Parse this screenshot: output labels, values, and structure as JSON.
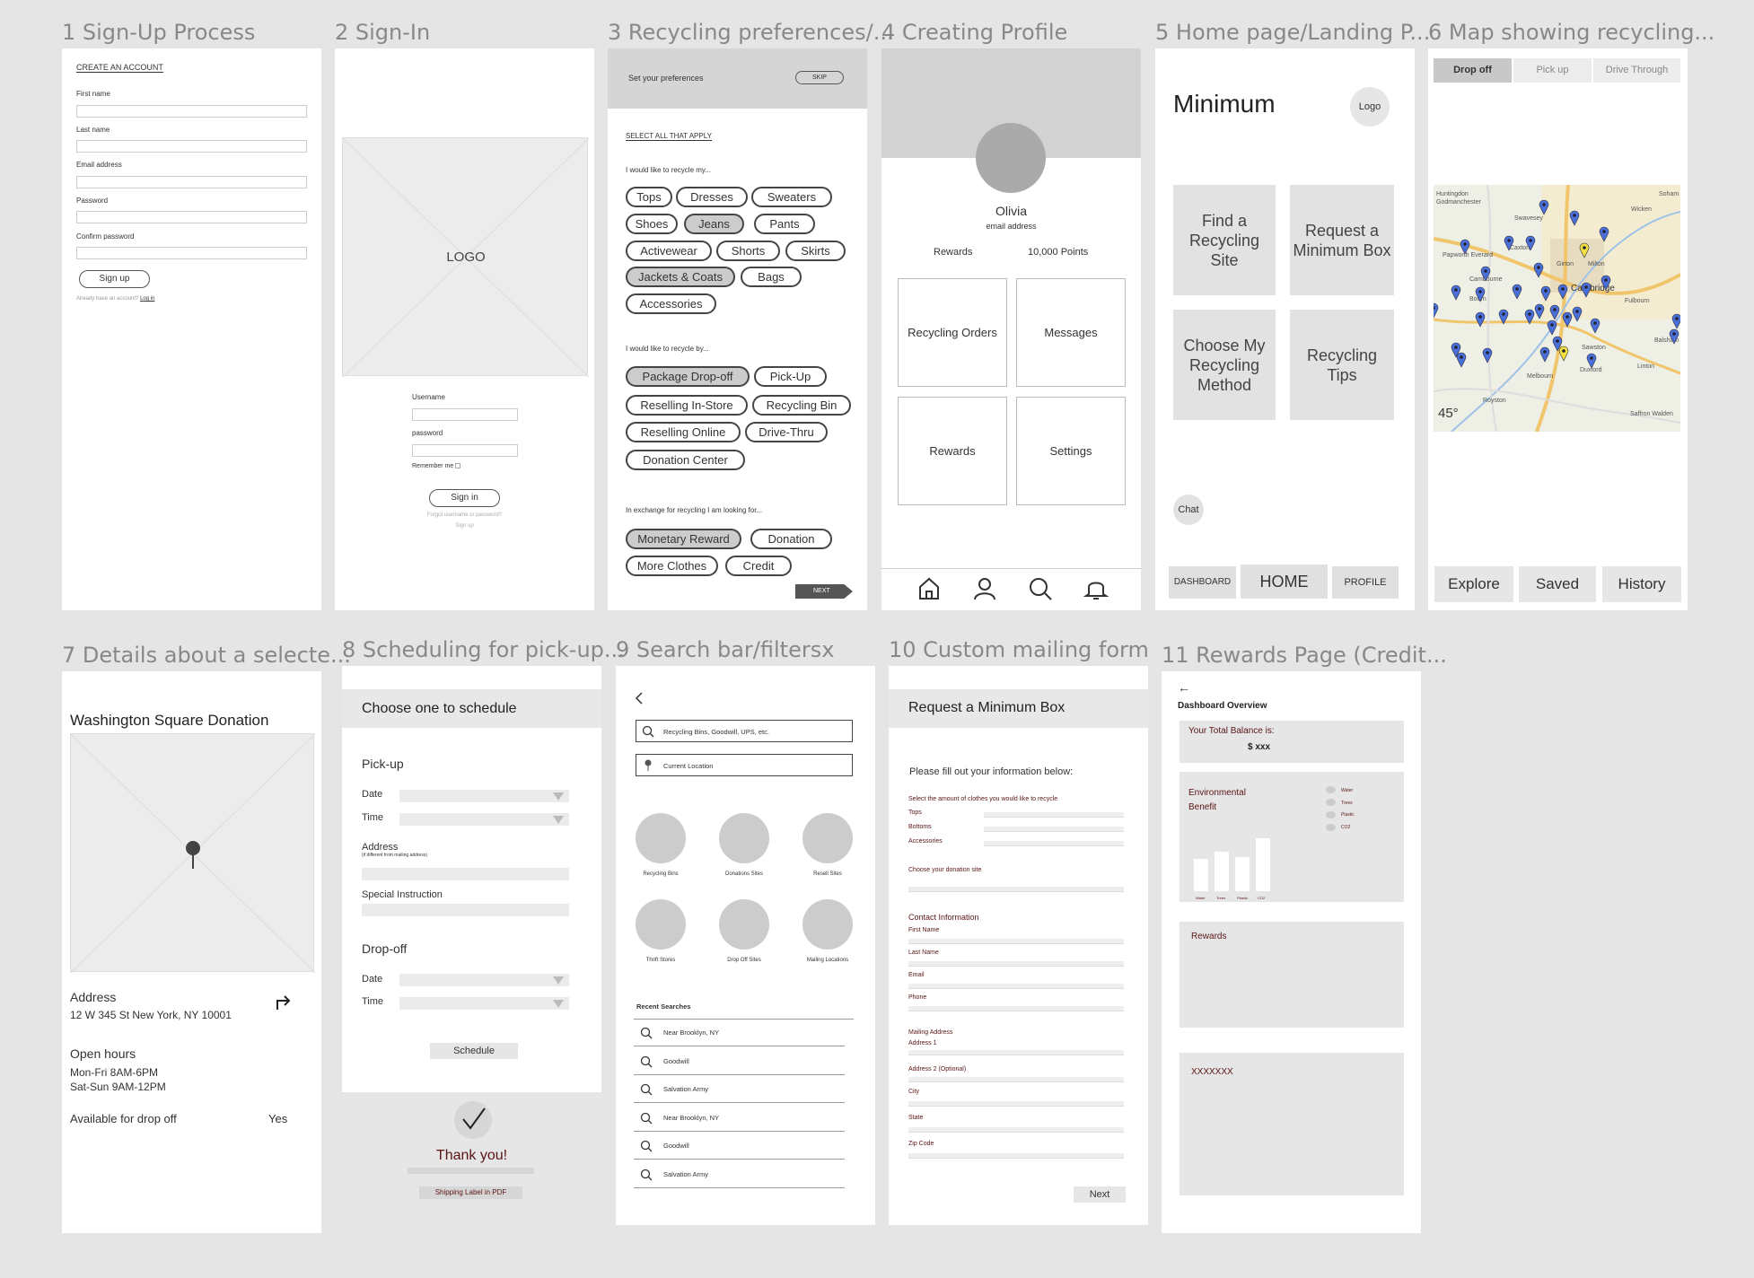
{
  "frame_titles": [
    "1 Sign-Up Process",
    "2 Sign-In",
    "3 Recycling preferences/...",
    "4 Creating Profile",
    "5 Home page/Landing P...",
    "6 Map showing recycling...",
    "7 Details about a selecte...",
    "8 Scheduling for pick-up...",
    "9 Search bar/filtersx",
    "10 Custom mailing form",
    "11 Rewards Page (Credit..."
  ],
  "signup": {
    "heading": "CREATE AN ACCOUNT",
    "labels": [
      "First name",
      "Last name",
      "Email address",
      "Password",
      "Confirm password"
    ],
    "button": "Sign up",
    "footer_text": "Already have an account?",
    "footer_link": "Log in"
  },
  "signin": {
    "logo": "LOGO",
    "username": "Username",
    "password": "password",
    "remember": "Remember me",
    "button": "Sign in",
    "forgot": "Forgot username or password?",
    "signup": "Sign up"
  },
  "prefs": {
    "header": "Set your preferences",
    "skip": "SKIP",
    "select_all": "SELECT ALL THAT APPLY",
    "q1": "I would like to recycle my...",
    "items1": [
      "Tops",
      "Dresses",
      "Sweaters",
      "Shoes",
      "Jeans",
      "Pants",
      "Activewear",
      "Shorts",
      "Skirts",
      "Jackets & Coats",
      "Bags",
      "Accessories"
    ],
    "q2": "I would like to recycle by...",
    "items2": [
      "Package Drop-off",
      "Pick-Up",
      "Reselling In-Store",
      "Recycling Bin",
      "Reselling Online",
      "Drive-Thru",
      "Donation Center"
    ],
    "q3": "In exchange for recycling I am looking for...",
    "items3": [
      "Monetary Reward",
      "Donation",
      "More Clothes",
      "Credit"
    ],
    "next": "NEXT"
  },
  "profile": {
    "name": "Olivia",
    "email": "email address",
    "rewards_label": "Rewards",
    "points": "10,000 Points",
    "tiles": [
      "Recycling Orders",
      "Messages",
      "Rewards",
      "Settings"
    ]
  },
  "home": {
    "title": "Minimum",
    "logo": "Logo",
    "tiles": [
      "Find a Recycling Site",
      "Request a Minimum Box",
      "Choose My Recycling Method",
      "Recycling Tips"
    ],
    "chat": "Chat",
    "nav": [
      "DASHBOARD",
      "HOME",
      "PROFILE"
    ]
  },
  "map": {
    "tabs": [
      "Drop off",
      "Pick up",
      "Drive Through"
    ],
    "places": [
      "Huntingdon",
      "Godmanchester",
      "Swavesey",
      "Soham",
      "Wicken",
      "Papworth Everard",
      "Caxton",
      "Cambourne",
      "Cambridge",
      "Girton",
      "Milton",
      "Fulbourn",
      "Bourn",
      "Balsham",
      "Sawston",
      "Linton",
      "Melbourn",
      "Royston",
      "Duxford",
      "Saffron Walden"
    ],
    "temperature": "45°",
    "bottom_tabs": [
      "Explore",
      "Saved",
      "History"
    ]
  },
  "details": {
    "title": "Washington Square Donation",
    "address_label": "Address",
    "address": "12 W 345 St New York, NY 10001",
    "hours_label": "Open hours",
    "hours1": "Mon-Fri 8AM-6PM",
    "hours2": "Sat-Sun 9AM-12PM",
    "available_label": "Available for drop off",
    "available": "Yes"
  },
  "schedule": {
    "header": "Choose one to schedule",
    "pickup": "Pick-up",
    "date": "Date",
    "time": "Time",
    "address": "Address",
    "address_note": "(if different from mailing address)",
    "special": "Special Instruction",
    "dropoff": "Drop-off",
    "button": "Schedule",
    "thanks": "Thank you!",
    "shipping": "Shipping Label in PDF"
  },
  "search": {
    "placeholder": "Recycling Bins, Goodwill, UPS, etc.",
    "location": "Current Location",
    "categories": [
      "Recycling Bins",
      "Donations Sites",
      "Resell Sites",
      "Thrift Stores",
      "Drop Off Sites",
      "Mailing Locations"
    ],
    "recent_label": "Recent Searches",
    "recent": [
      "Near Brooklyn, NY",
      "Goodwill",
      "Salvation Army",
      "Near Brooklyn, NY",
      "Goodwill",
      "Salvation Army"
    ]
  },
  "mailing": {
    "title": "Request a Minimum Box",
    "intro": "Please fill out your information below:",
    "amount_label": "Select the amount of clothes you would like to recycle",
    "amount_items": [
      "Tops",
      "Bottoms",
      "Accessories"
    ],
    "site_label": "Choose your donation site",
    "contact": "Contact Information",
    "contact_fields": [
      "First Name",
      "Last Name",
      "Email",
      "Phone"
    ],
    "mailing_address": "Mailing Address",
    "address_fields": [
      "Address 1",
      "Address 2 (Optional)",
      "City",
      "State",
      "Zip Code"
    ],
    "next": "Next"
  },
  "rewards": {
    "back": "←",
    "title": "Dashboard Overview",
    "balance_label": "Your Total Balance is:",
    "balance": "$ xxx",
    "env": "Environmental Benefit",
    "legend": [
      "Water",
      "Trees",
      "Plastic",
      "CO2"
    ],
    "bars": [
      0.38,
      0.46,
      0.4,
      0.62
    ],
    "rewards": "Rewards",
    "xxx": "XXXXXXX"
  },
  "colors": {
    "canvas": "#e5e5e5",
    "pin_blue": "#4a6fd8",
    "pin_yellow": "#f0e040",
    "maroon": "#5a1414"
  }
}
